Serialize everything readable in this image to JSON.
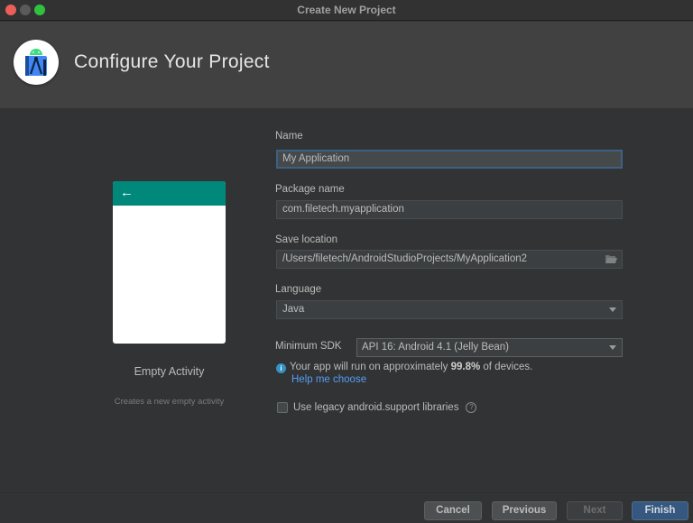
{
  "window": {
    "title": "Create New Project"
  },
  "header": {
    "title": "Configure Your Project",
    "logo_icon": "android-studio-logo"
  },
  "template": {
    "name": "Empty Activity",
    "description": "Creates a new empty activity",
    "preview_back_icon": "←",
    "accent_color": "#00897b"
  },
  "form": {
    "name": {
      "label": "Name",
      "value": "My Application"
    },
    "package": {
      "label": "Package name",
      "value": "com.filetech.myapplication"
    },
    "save_location": {
      "label": "Save location",
      "value": "/Users/filetech/AndroidStudioProjects/MyApplication2",
      "icon": "folder-icon"
    },
    "language": {
      "label": "Language",
      "value": "Java"
    },
    "min_sdk": {
      "label": "Minimum SDK",
      "value": "API 16: Android 4.1 (Jelly Bean)"
    },
    "info": {
      "prefix": "Your app will run on approximately ",
      "percent": "99.8%",
      "suffix": " of devices.",
      "icon": "i"
    },
    "help_link": "Help me choose",
    "legacy": {
      "label": "Use legacy android.support libraries",
      "checked": false,
      "help_icon": "?"
    }
  },
  "footer": {
    "cancel": "Cancel",
    "previous": "Previous",
    "next": "Next",
    "finish": "Finish"
  }
}
